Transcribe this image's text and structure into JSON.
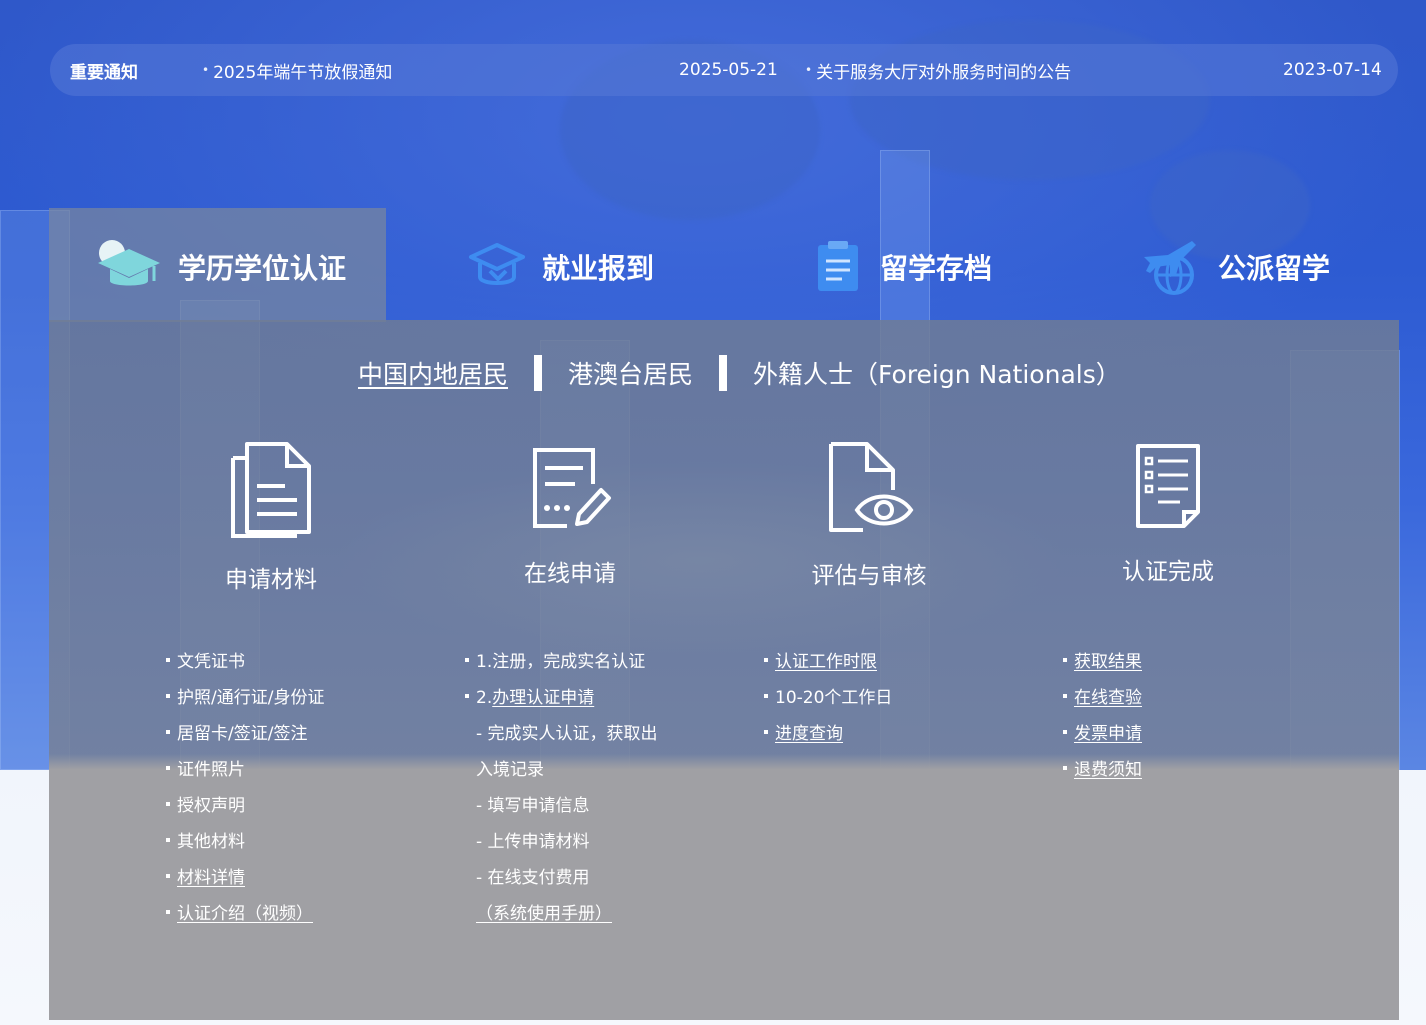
{
  "notice": {
    "label": "重要通知",
    "items": [
      {
        "title": "2025年端午节放假通知",
        "date": "2025-05-21"
      },
      {
        "title": "关于服务大厅对外服务时间的公告",
        "date": "2023-07-14"
      }
    ]
  },
  "tabs": [
    {
      "label": "学历学位认证",
      "icon": "graduation-cap-icon",
      "active": true
    },
    {
      "label": "就业报到",
      "icon": "graduation-cap-outline-icon",
      "active": false
    },
    {
      "label": "留学存档",
      "icon": "document-archive-icon",
      "active": false
    },
    {
      "label": "公派留学",
      "icon": "airplane-globe-icon",
      "active": false
    }
  ],
  "segments": [
    {
      "label": "中国内地居民",
      "active": true
    },
    {
      "label": "港澳台居民",
      "active": false
    },
    {
      "label": "外籍人士（Foreign Nationals）",
      "active": false
    }
  ],
  "steps": [
    {
      "title": "申请材料",
      "icon": "documents-icon"
    },
    {
      "title": "在线申请",
      "icon": "form-edit-icon"
    },
    {
      "title": "评估与审核",
      "icon": "document-eye-icon"
    },
    {
      "title": "认证完成",
      "icon": "checklist-icon"
    }
  ],
  "columns": {
    "materials": [
      "文凭证书",
      "护照/通行证/身份证",
      "居留卡/签证/签注",
      "证件照片",
      "授权声明",
      "其他材料",
      "材料详情",
      "认证介绍（视频）"
    ],
    "apply": {
      "step1": "1.注册，完成实名认证",
      "step2_prefix": "2.",
      "step2_link": "办理认证申请",
      "sub1a": "- 完成实人认证，获取出",
      "sub1b": "入境记录",
      "sub2": "- 填写申请信息",
      "sub3": "- 上传申请材料",
      "sub4": "- 在线支付费用",
      "manual": "（系统使用手册）"
    },
    "review": [
      "认证工作时限",
      "10-20个工作日",
      "进度查询"
    ],
    "complete": [
      "获取结果",
      "在线查验",
      "发票申请",
      "退费须知"
    ]
  },
  "colors": {
    "brand_blue": "#2f58c9",
    "panel_gray": "#a0a0a4",
    "icon_teal": "#7fd6dc",
    "icon_blue": "#3e8cf0"
  }
}
